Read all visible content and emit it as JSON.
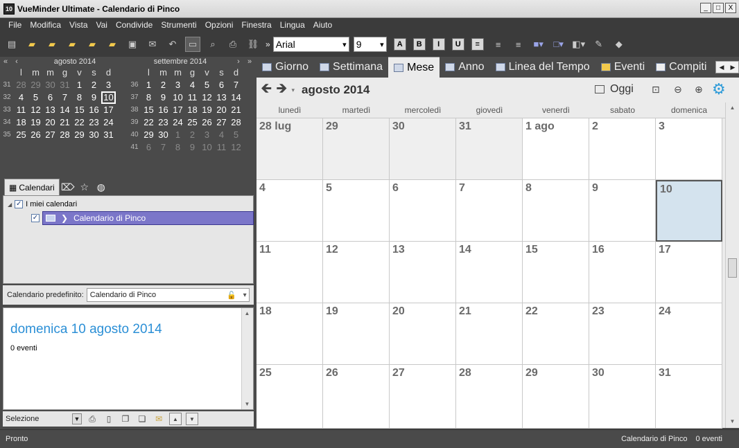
{
  "window": {
    "app_badge": "10",
    "title": "VueMinder Ultimate - Calendario di Pinco",
    "minimize": "_",
    "maximize": "□",
    "close": "X"
  },
  "menu": [
    "File",
    "Modifica",
    "Vista",
    "Vai",
    "Condivide",
    "Strumenti",
    "Opzioni",
    "Finestra",
    "Lingua",
    "Aiuto"
  ],
  "toolbar": {
    "font": "Arial",
    "size": "9",
    "bold": "B",
    "italic": "I",
    "underline": "U",
    "overflow": "»",
    "icons": [
      "new-event-icon",
      "open-icon",
      "calendar-add-icon",
      "export-icon",
      "import-icon",
      "notes-icon",
      "sync-icon",
      "mail-icon",
      "undo-icon",
      "comment-icon",
      "search-icon",
      "print-icon",
      "link-icon"
    ]
  },
  "mini_calendars": [
    {
      "title": "agosto 2014",
      "nav_left": "«",
      "nav_left2": "‹",
      "dow": [
        "l",
        "m",
        "m",
        "g",
        "v",
        "s",
        "d"
      ],
      "weeks": [
        {
          "wk": "31",
          "days": [
            {
              "d": "28",
              "o": true
            },
            {
              "d": "29",
              "o": true
            },
            {
              "d": "30",
              "o": true
            },
            {
              "d": "31",
              "o": true
            },
            {
              "d": "1"
            },
            {
              "d": "2"
            },
            {
              "d": "3"
            }
          ]
        },
        {
          "wk": "32",
          "days": [
            {
              "d": "4"
            },
            {
              "d": "5"
            },
            {
              "d": "6"
            },
            {
              "d": "7"
            },
            {
              "d": "8"
            },
            {
              "d": "9"
            },
            {
              "d": "10",
              "t": true
            }
          ]
        },
        {
          "wk": "33",
          "days": [
            {
              "d": "11"
            },
            {
              "d": "12"
            },
            {
              "d": "13"
            },
            {
              "d": "14"
            },
            {
              "d": "15"
            },
            {
              "d": "16"
            },
            {
              "d": "17"
            }
          ]
        },
        {
          "wk": "34",
          "days": [
            {
              "d": "18"
            },
            {
              "d": "19"
            },
            {
              "d": "20"
            },
            {
              "d": "21"
            },
            {
              "d": "22"
            },
            {
              "d": "23"
            },
            {
              "d": "24"
            }
          ]
        },
        {
          "wk": "35",
          "days": [
            {
              "d": "25"
            },
            {
              "d": "26"
            },
            {
              "d": "27"
            },
            {
              "d": "28"
            },
            {
              "d": "29"
            },
            {
              "d": "30"
            },
            {
              "d": "31"
            }
          ]
        }
      ]
    },
    {
      "title": "settembre 2014",
      "nav_right": "›",
      "nav_right2": "»",
      "dow": [
        "l",
        "m",
        "m",
        "g",
        "v",
        "s",
        "d"
      ],
      "weeks": [
        {
          "wk": "36",
          "days": [
            {
              "d": "1"
            },
            {
              "d": "2"
            },
            {
              "d": "3"
            },
            {
              "d": "4"
            },
            {
              "d": "5"
            },
            {
              "d": "6"
            },
            {
              "d": "7"
            }
          ]
        },
        {
          "wk": "37",
          "days": [
            {
              "d": "8"
            },
            {
              "d": "9"
            },
            {
              "d": "10"
            },
            {
              "d": "11"
            },
            {
              "d": "12"
            },
            {
              "d": "13"
            },
            {
              "d": "14"
            }
          ]
        },
        {
          "wk": "38",
          "days": [
            {
              "d": "15"
            },
            {
              "d": "16"
            },
            {
              "d": "17"
            },
            {
              "d": "18"
            },
            {
              "d": "19"
            },
            {
              "d": "20"
            },
            {
              "d": "21"
            }
          ]
        },
        {
          "wk": "39",
          "days": [
            {
              "d": "22"
            },
            {
              "d": "23"
            },
            {
              "d": "24"
            },
            {
              "d": "25"
            },
            {
              "d": "26"
            },
            {
              "d": "27"
            },
            {
              "d": "28"
            }
          ]
        },
        {
          "wk": "40",
          "days": [
            {
              "d": "29"
            },
            {
              "d": "30"
            },
            {
              "d": "1",
              "o": true
            },
            {
              "d": "2",
              "o": true
            },
            {
              "d": "3",
              "o": true
            },
            {
              "d": "4",
              "o": true
            },
            {
              "d": "5",
              "o": true
            }
          ]
        },
        {
          "wk": "41",
          "days": [
            {
              "d": "6",
              "o": true
            },
            {
              "d": "7",
              "o": true
            },
            {
              "d": "8",
              "o": true
            },
            {
              "d": "9",
              "o": true
            },
            {
              "d": "10",
              "o": true
            },
            {
              "d": "11",
              "o": true
            },
            {
              "d": "12",
              "o": true
            }
          ]
        }
      ]
    }
  ],
  "calendars_panel": {
    "tab_label": "Calendari",
    "root_label": "I miei calendari",
    "selected_calendar": "Calendario di Pinco",
    "default_label": "Calendario predefinito:",
    "default_value": "Calendario di Pinco"
  },
  "detail": {
    "date": "domenica 10 agosto 2014",
    "count": "0 eventi"
  },
  "bottom_tools": {
    "selection": "Selezione"
  },
  "view_tabs": [
    "Giorno",
    "Settimana",
    "Mese",
    "Anno",
    "Linea del Tempo",
    "Eventi",
    "Compiti"
  ],
  "active_view": "Mese",
  "cal_header": {
    "month": "agosto 2014",
    "today": "Oggi"
  },
  "weekday_headers": [
    "lunedì",
    "martedì",
    "mercoledì",
    "giovedì",
    "venerdì",
    "sabato",
    "domenica"
  ],
  "month_cells": [
    {
      "n": "28 lug",
      "o": true
    },
    {
      "n": "29",
      "o": true
    },
    {
      "n": "30",
      "o": true
    },
    {
      "n": "31",
      "o": true
    },
    {
      "n": "1 ago"
    },
    {
      "n": "2"
    },
    {
      "n": "3"
    },
    {
      "n": "4"
    },
    {
      "n": "5"
    },
    {
      "n": "6"
    },
    {
      "n": "7"
    },
    {
      "n": "8"
    },
    {
      "n": "9"
    },
    {
      "n": "10",
      "t": true
    },
    {
      "n": "11"
    },
    {
      "n": "12"
    },
    {
      "n": "13"
    },
    {
      "n": "14"
    },
    {
      "n": "15"
    },
    {
      "n": "16"
    },
    {
      "n": "17"
    },
    {
      "n": "18"
    },
    {
      "n": "19"
    },
    {
      "n": "20"
    },
    {
      "n": "21"
    },
    {
      "n": "22"
    },
    {
      "n": "23"
    },
    {
      "n": "24"
    },
    {
      "n": "25"
    },
    {
      "n": "26"
    },
    {
      "n": "27"
    },
    {
      "n": "28"
    },
    {
      "n": "29"
    },
    {
      "n": "30"
    },
    {
      "n": "31"
    }
  ],
  "status": {
    "left": "Pronto",
    "calendar": "Calendario di Pinco",
    "events": "0 eventi"
  },
  "colors": {
    "accent": "#2e9bd8",
    "selected_row": "#7b76c9",
    "today_cell": "#d4e3ee"
  }
}
